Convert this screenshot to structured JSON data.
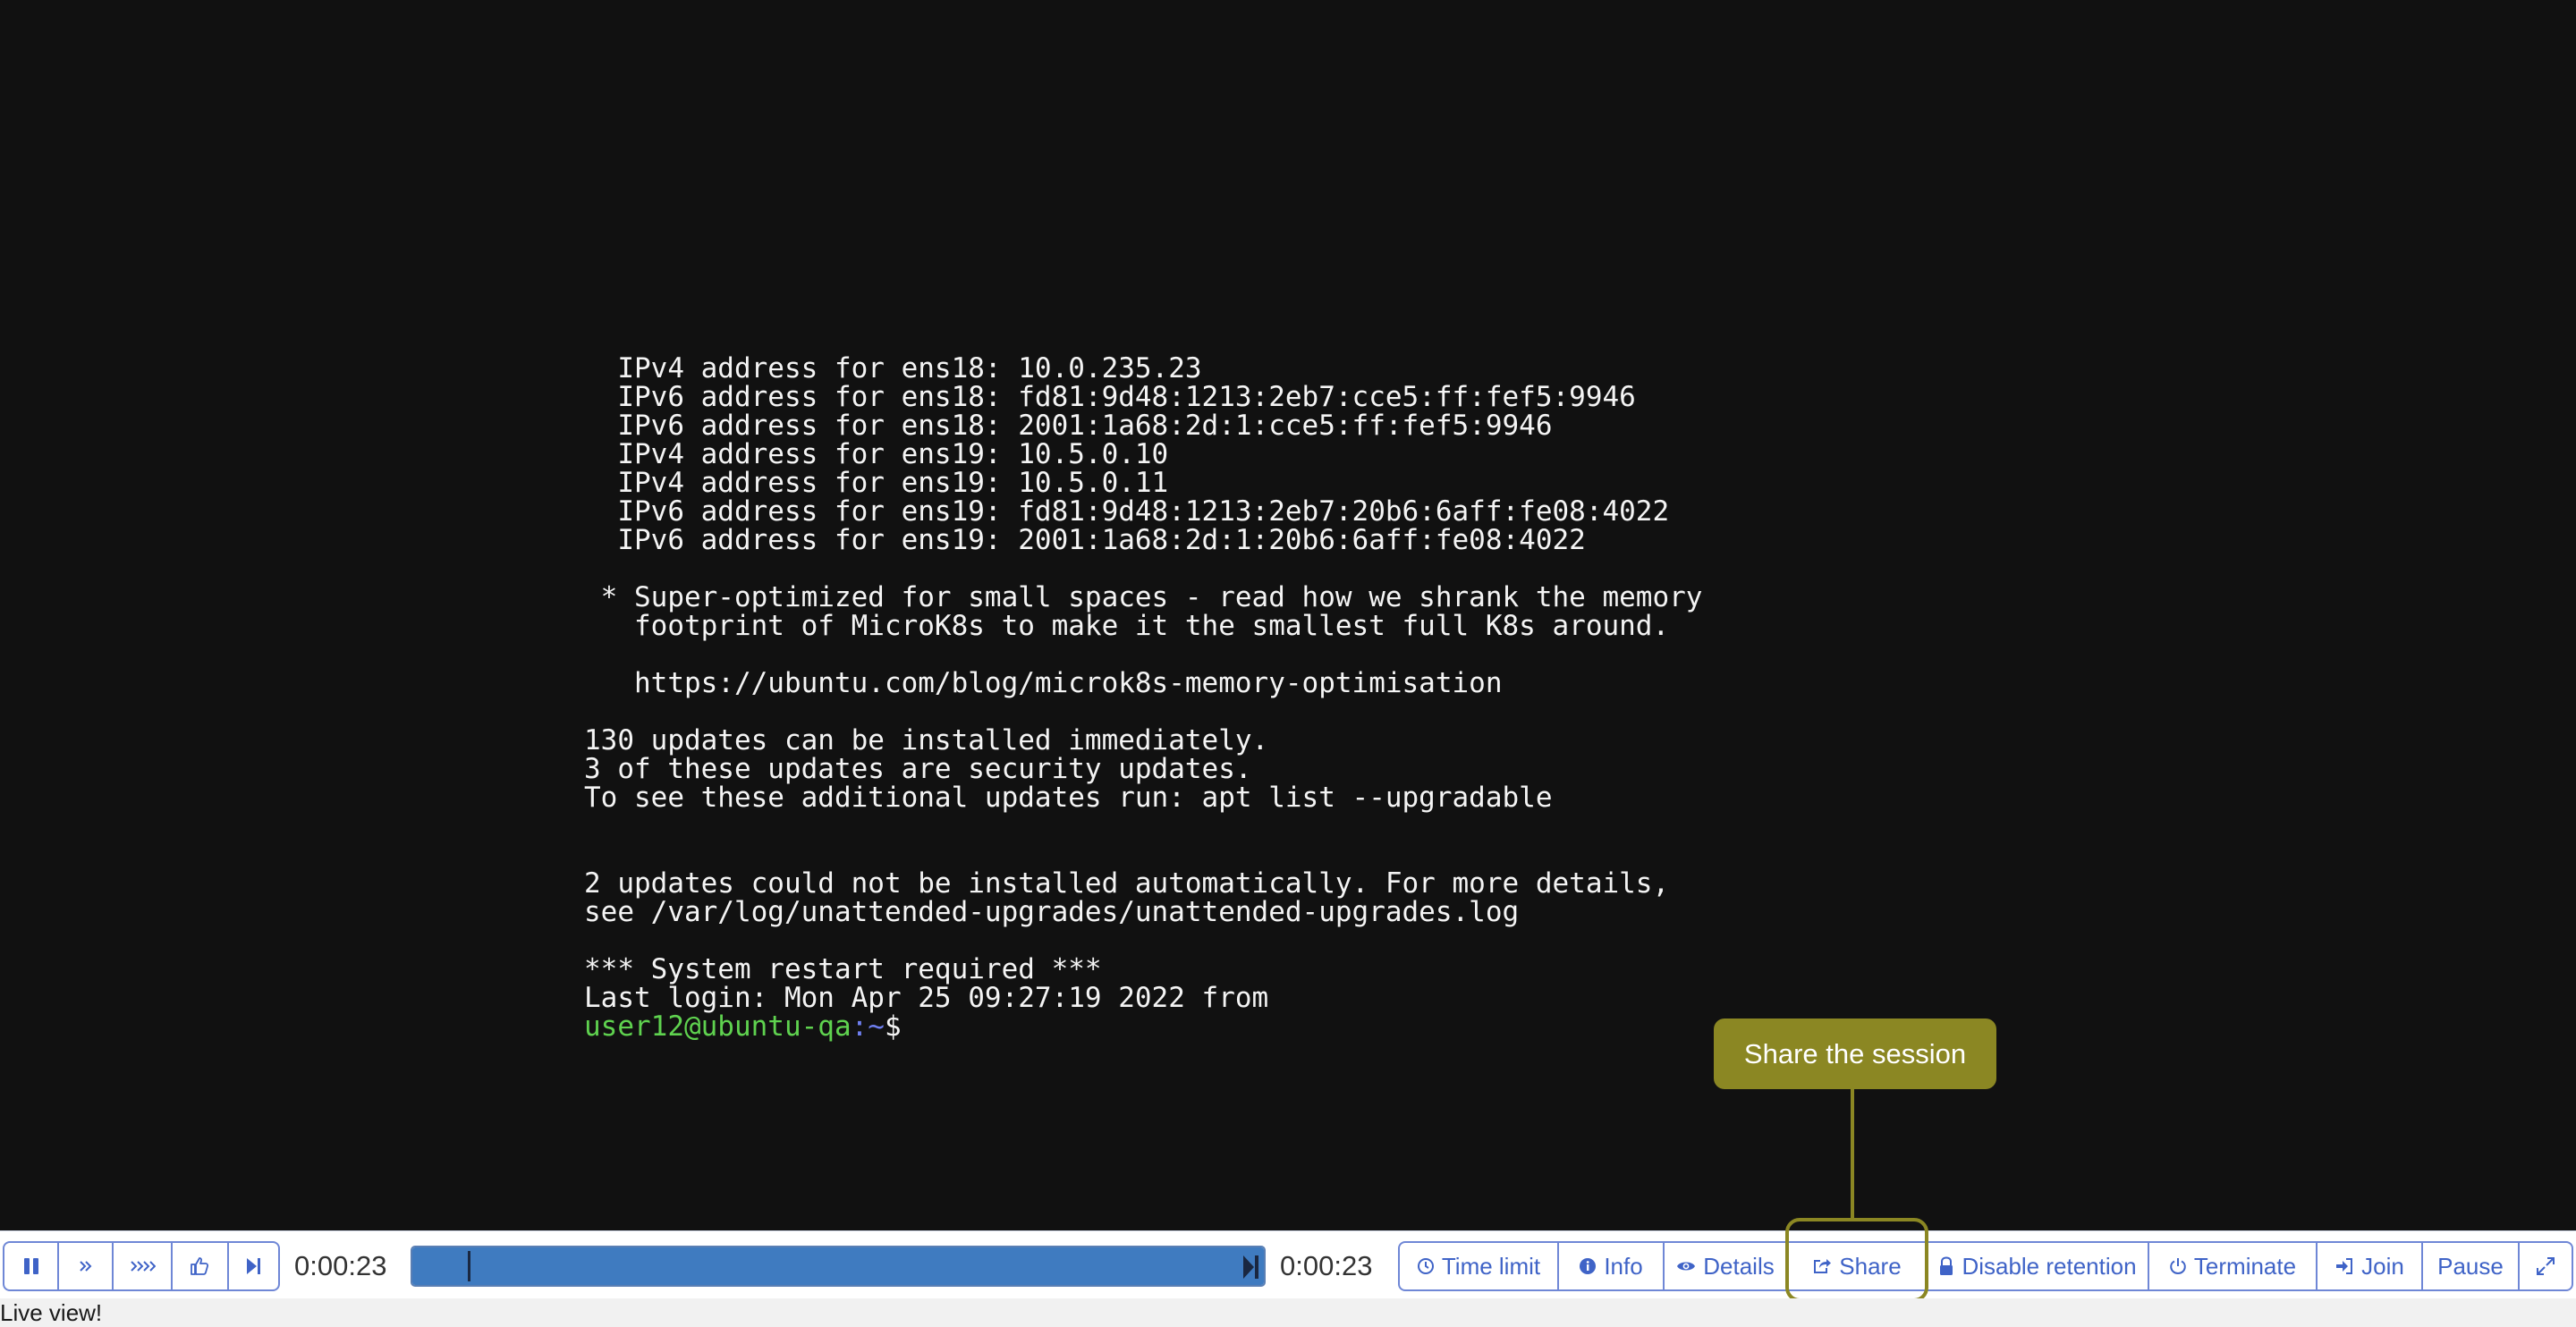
{
  "terminal": {
    "lines": [
      "  IPv4 address for ens18: 10.0.235.23",
      "  IPv6 address for ens18: fd81:9d48:1213:2eb7:cce5:ff:fef5:9946",
      "  IPv6 address for ens18: 2001:1a68:2d:1:cce5:ff:fef5:9946",
      "  IPv4 address for ens19: 10.5.0.10",
      "  IPv4 address for ens19: 10.5.0.11",
      "  IPv6 address for ens19: fd81:9d48:1213:2eb7:20b6:6aff:fe08:4022",
      "  IPv6 address for ens19: 2001:1a68:2d:1:20b6:6aff:fe08:4022",
      "",
      " * Super-optimized for small spaces - read how we shrank the memory",
      "   footprint of MicroK8s to make it the smallest full K8s around.",
      "",
      "   https://ubuntu.com/blog/microk8s-memory-optimisation",
      "",
      "130 updates can be installed immediately.",
      "3 of these updates are security updates.",
      "To see these additional updates run: apt list --upgradable",
      "",
      "",
      "2 updates could not be installed automatically. For more details,",
      "see /var/log/unattended-upgrades/unattended-upgrades.log",
      "",
      "*** System restart required ***",
      "Last login: Mon Apr 25 09:27:19 2022 from"
    ],
    "prompt_user_host": "user12@ubuntu-qa",
    "prompt_sep": ":",
    "prompt_path": "~",
    "prompt_symbol": "$"
  },
  "tooltip": {
    "text": "Share the session"
  },
  "playback": {
    "current_time": "0:00:23",
    "total_time": "0:00:23",
    "progress_fraction": 1.0,
    "buttons": [
      {
        "name": "pause-button",
        "icon": "pause-icon",
        "glyph": "❚❚"
      },
      {
        "name": "speed-up-button",
        "icon": "double-chevron-right-icon",
        "glyph": "»"
      },
      {
        "name": "speed-up-more-button",
        "icon": "triple-chevron-right-icon",
        "glyph": "»»"
      },
      {
        "name": "reactions-button",
        "icon": "thumbs-up-icon",
        "glyph": "👍"
      },
      {
        "name": "skip-to-end-button",
        "icon": "skip-end-icon",
        "glyph": "⏭"
      }
    ]
  },
  "actions": {
    "time_limit": "Time limit",
    "info": "Info",
    "details": "Details",
    "share": "Share",
    "disable_retention": "Disable retention",
    "terminate": "Terminate",
    "join": "Join",
    "pause": "Pause"
  },
  "status": {
    "text": "Live view!"
  },
  "colors": {
    "terminal_bg": "#111111",
    "terminal_fg": "#f4f4f4",
    "prompt_user": "#5fd24f",
    "prompt_path": "#6f7ff0",
    "accent": "#3f63c7",
    "tooltip_bg": "#8b8723",
    "progress_fill": "#3f7bc0"
  }
}
